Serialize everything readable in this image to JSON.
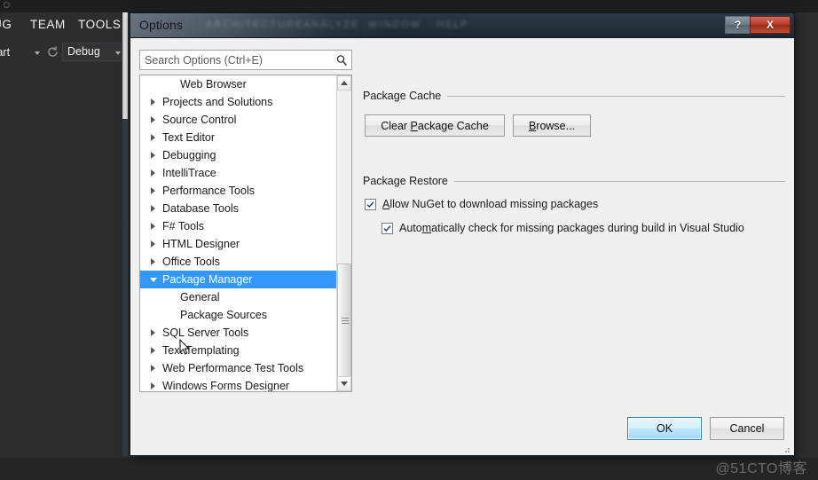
{
  "vs_window": {
    "menu_items": [
      "UG",
      "TEAM",
      "TOOLS"
    ],
    "toolbar": {
      "start_label": "tart",
      "refresh_icon": "refresh-icon",
      "config_dropdown_value": "Debug"
    }
  },
  "dialog": {
    "title": "Options",
    "ghost_menu_items": [
      "ARCHITECTURE",
      "ANALYZE",
      "WINDOW",
      "HELP"
    ],
    "window_buttons": {
      "help_label": "?",
      "close_label": "X"
    },
    "search": {
      "placeholder": "Search Options (Ctrl+E)",
      "value": "",
      "icon": "search-icon"
    },
    "tree": {
      "items": [
        {
          "label": "Web Browser",
          "level": 2,
          "arrow": "none",
          "selected": false
        },
        {
          "label": "Projects and Solutions",
          "level": 1,
          "arrow": "collapsed",
          "selected": false
        },
        {
          "label": "Source Control",
          "level": 1,
          "arrow": "collapsed",
          "selected": false
        },
        {
          "label": "Text Editor",
          "level": 1,
          "arrow": "collapsed",
          "selected": false
        },
        {
          "label": "Debugging",
          "level": 1,
          "arrow": "collapsed",
          "selected": false
        },
        {
          "label": "IntelliTrace",
          "level": 1,
          "arrow": "collapsed",
          "selected": false
        },
        {
          "label": "Performance Tools",
          "level": 1,
          "arrow": "collapsed",
          "selected": false
        },
        {
          "label": "Database Tools",
          "level": 1,
          "arrow": "collapsed",
          "selected": false
        },
        {
          "label": "F# Tools",
          "level": 1,
          "arrow": "collapsed",
          "selected": false
        },
        {
          "label": "HTML Designer",
          "level": 1,
          "arrow": "collapsed",
          "selected": false
        },
        {
          "label": "Office Tools",
          "level": 1,
          "arrow": "collapsed",
          "selected": false
        },
        {
          "label": "Package Manager",
          "level": 1,
          "arrow": "expanded",
          "selected": true
        },
        {
          "label": "General",
          "level": 2,
          "arrow": "none",
          "selected": false
        },
        {
          "label": "Package Sources",
          "level": 2,
          "arrow": "none",
          "selected": false
        },
        {
          "label": "SQL Server Tools",
          "level": 1,
          "arrow": "collapsed",
          "selected": false
        },
        {
          "label": "Text Templating",
          "level": 1,
          "arrow": "collapsed",
          "selected": false
        },
        {
          "label": "Web Performance Test Tools",
          "level": 1,
          "arrow": "collapsed",
          "selected": false
        },
        {
          "label": "Windows Forms Designer",
          "level": 1,
          "arrow": "collapsed",
          "selected": false
        }
      ],
      "scrollbar": {
        "up_icon": "scroll-up-icon",
        "down_icon": "scroll-down-icon"
      }
    },
    "content": {
      "package_cache": {
        "group_label": "Package Cache",
        "clear_button": {
          "pre": "Clear ",
          "accel": "P",
          "post": "ackage Cache"
        },
        "browse_button": {
          "pre": "",
          "accel": "B",
          "post": "rowse..."
        }
      },
      "package_restore": {
        "group_label": "Package Restore",
        "allow_checkbox": {
          "pre": "",
          "accel": "A",
          "post": "llow NuGet to download missing packages",
          "checked": true
        },
        "auto_checkbox": {
          "pre": "Auto",
          "accel": "m",
          "post": "atically check for missing packages during build in Visual Studio",
          "checked": true
        }
      }
    },
    "footer": {
      "ok_label": "OK",
      "cancel_label": "Cancel"
    },
    "colors": {
      "selection": "#3399ff",
      "dialog_bg": "#f0f0f0",
      "titlebar": "#243039",
      "close_button": "#b83a28",
      "vs_background": "#2d2d30"
    }
  },
  "watermark": {
    "text": "@51CTO博客"
  }
}
